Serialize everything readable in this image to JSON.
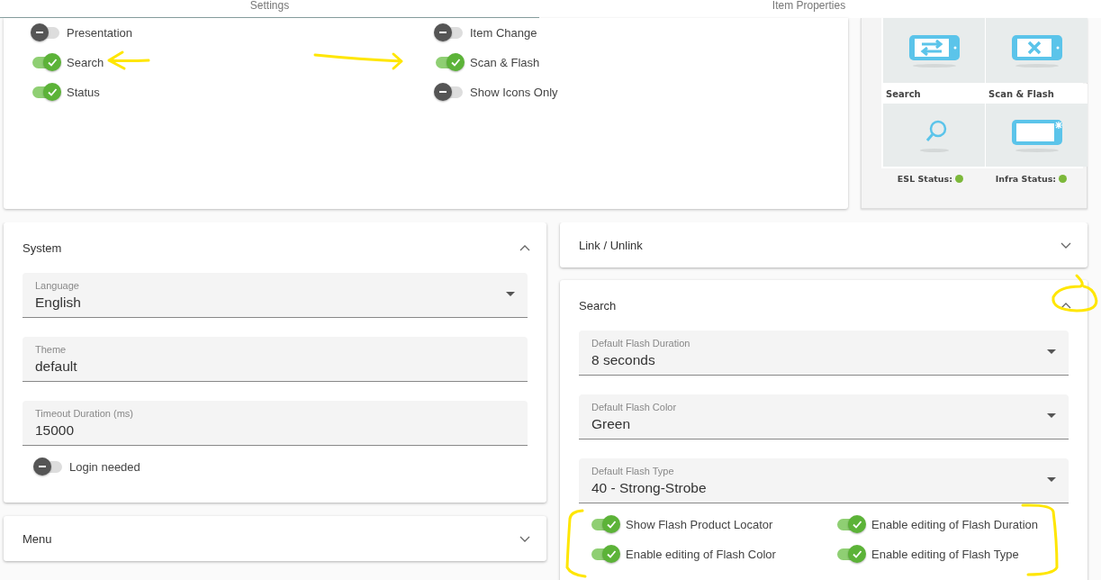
{
  "tabs": [
    {
      "label": "Settings",
      "selected": true
    },
    {
      "label": "Item Properties",
      "selected": false
    }
  ],
  "display_toggles": [
    {
      "label": "Presentation",
      "on": false
    },
    {
      "label": "Item Change",
      "on": false
    },
    {
      "label": "Search",
      "on": true
    },
    {
      "label": "Scan & Flash",
      "on": true
    },
    {
      "label": "Status",
      "on": true
    },
    {
      "label": "Show Icons Only",
      "on": false
    }
  ],
  "tiles": [
    {
      "kind": "swap"
    },
    {
      "kind": "cancel"
    },
    {
      "kind": "search",
      "label": "Search"
    },
    {
      "kind": "flash",
      "label": "Scan & Flash"
    }
  ],
  "status": [
    {
      "label": "ESL Status:",
      "color": "#7cb83a"
    },
    {
      "label": "Infra Status:",
      "color": "#7cb83a"
    }
  ],
  "left_panels": [
    {
      "title": "System",
      "expanded": true,
      "fields": [
        {
          "kind": "select",
          "label": "Language",
          "value": "English"
        },
        {
          "kind": "text",
          "label": "Theme",
          "value": "default"
        },
        {
          "kind": "text",
          "label": "Timeout Duration (ms)",
          "value": "15000"
        }
      ],
      "toggles": [
        {
          "label": "Login needed",
          "on": false
        }
      ]
    },
    {
      "title": "Menu",
      "expanded": false
    }
  ],
  "right_panels": [
    {
      "title": "Link / Unlink",
      "expanded": false
    },
    {
      "title": "Search",
      "expanded": true,
      "fields": [
        {
          "kind": "select",
          "label": "Default Flash Duration",
          "value": "8 seconds"
        },
        {
          "kind": "select",
          "label": "Default Flash Color",
          "value": "Green"
        },
        {
          "kind": "select",
          "label": "Default Flash Type",
          "value": "40 - Strong-Strobe"
        }
      ],
      "toggles": [
        {
          "label": "Show Flash Product Locator",
          "on": true
        },
        {
          "label": "Enable editing of Flash Duration",
          "on": true
        },
        {
          "label": "Enable editing of Flash Color",
          "on": true
        },
        {
          "label": "Enable editing of Flash Type",
          "on": true
        }
      ]
    }
  ]
}
